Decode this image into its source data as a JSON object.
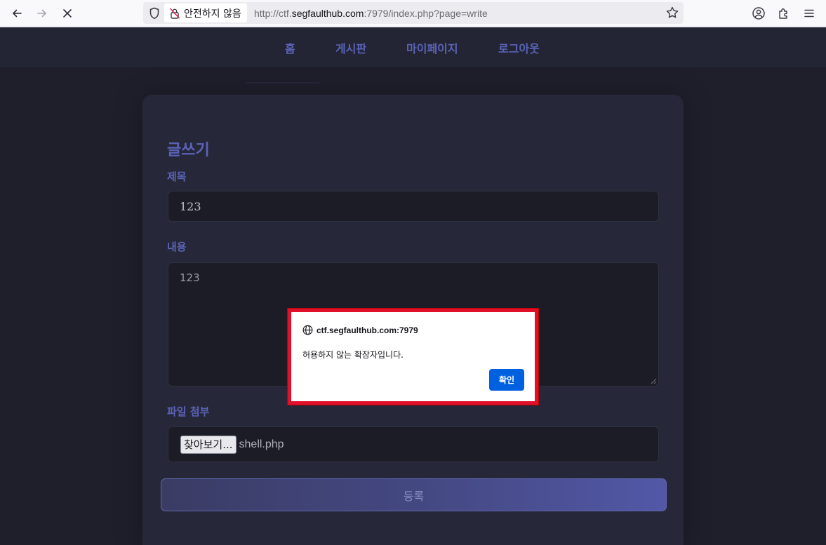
{
  "browser": {
    "insecure_label": "안전하지 않음",
    "url_prefix": "http://ctf.",
    "url_domain": "segfaulthub.com",
    "url_suffix": ":7979/index.php?page=write"
  },
  "nav": {
    "items": [
      {
        "label": "홈"
      },
      {
        "label": "게시판"
      },
      {
        "label": "마이페이지"
      },
      {
        "label": "로그아웃"
      }
    ]
  },
  "form": {
    "heading": "글쓰기",
    "title_label": "제목",
    "title_value": "123",
    "content_label": "내용",
    "content_value": "123",
    "file_label": "파일 첨부",
    "browse_label": "찾아보기...",
    "file_name": "shell.php",
    "submit_label": "등록"
  },
  "alert": {
    "origin": "ctf.segfaulthub.com:7979",
    "message": "허용하지 않는 확장자입니다.",
    "ok_label": "확인"
  },
  "colors": {
    "accent": "#5b63b8",
    "page_bg": "#1e1f2b",
    "card_bg": "#262738",
    "alert_highlight": "#e0102b",
    "ok_button": "#0061e0"
  }
}
